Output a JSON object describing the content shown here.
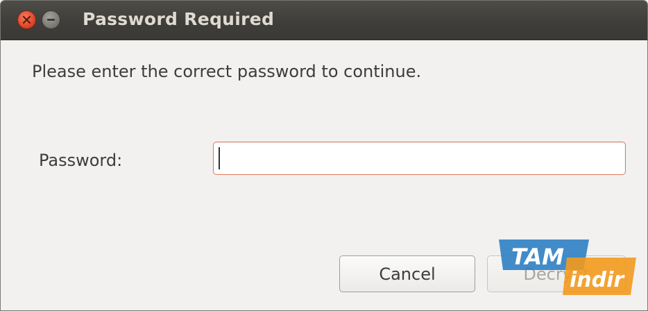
{
  "window": {
    "title": "Password Required",
    "controls": {
      "close_icon": "close-icon",
      "minimize_icon": "minimize-icon"
    }
  },
  "dialog": {
    "message": "Please enter the correct password to continue.",
    "password_label": "Password:",
    "password_value": "",
    "password_placeholder": ""
  },
  "buttons": {
    "cancel_label": "Cancel",
    "decrypt_label": "Decrypt",
    "decrypt_enabled": false
  },
  "watermark": {
    "line1": "TAM",
    "line2": "indir"
  },
  "colors": {
    "titlebar": "#3e3d39",
    "close_button": "#e0482a",
    "input_focus_border": "#e07a56",
    "background": "#f2f1f0",
    "watermark_blue": "#2f7fc4",
    "watermark_orange": "#f39a1d"
  }
}
